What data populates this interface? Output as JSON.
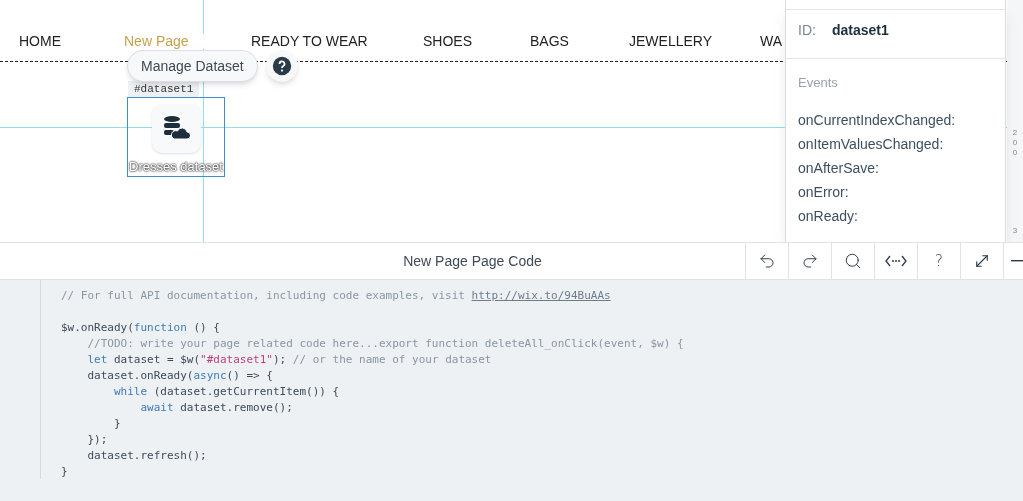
{
  "nav": {
    "items": [
      {
        "label": "HOME",
        "selected": false
      },
      {
        "label": "New Page",
        "selected": true
      },
      {
        "label": "READY TO WEAR",
        "selected": false
      },
      {
        "label": "SHOES",
        "selected": false
      },
      {
        "label": "BAGS",
        "selected": false
      },
      {
        "label": "JEWELLERY",
        "selected": false
      },
      {
        "label": "WA",
        "selected": false
      }
    ]
  },
  "dataset_element": {
    "manage_button": "Manage Dataset",
    "id_tag": "#dataset1",
    "label": "Dresses dataset"
  },
  "properties_panel": {
    "id_label": "ID:",
    "id_value": "dataset1",
    "events_heading": "Events",
    "events": [
      "onCurrentIndexChanged:",
      "onItemValuesChanged:",
      "onAfterSave:",
      "onError:",
      "onReady:"
    ]
  },
  "ruler_labels": [
    "2",
    "0",
    "0",
    "3"
  ],
  "code_panel": {
    "title": "New Page Page Code",
    "toolbar": [
      {
        "kind": "undo"
      },
      {
        "kind": "redo"
      },
      {
        "kind": "search"
      },
      {
        "kind": "snippets"
      },
      {
        "kind": "help",
        "label": "?"
      },
      {
        "kind": "expand"
      },
      {
        "kind": "minimize"
      }
    ],
    "lines": [
      [
        {
          "kind": "comment",
          "text": "// For full API documentation, including code examples, visit "
        },
        {
          "kind": "link",
          "text": "http://wix.to/94BuAAs"
        }
      ],
      [
        {
          "kind": "blank_before"
        },
        {
          "kind": "plain",
          "text": "$w.onReady("
        },
        {
          "kind": "keyword",
          "text": "function"
        },
        {
          "kind": "plain",
          "text": " () {"
        }
      ],
      [
        {
          "kind": "comment",
          "text": "    //TODO: write your page related code here...export function deleteAll_onClick(event, $w) {"
        }
      ],
      [
        {
          "kind": "keyword",
          "text": "    let"
        },
        {
          "kind": "plain",
          "text": " dataset = $w("
        },
        {
          "kind": "string",
          "text": "\"#dataset1\""
        },
        {
          "kind": "plain",
          "text": "); "
        },
        {
          "kind": "comment",
          "text": "// or the name of your dataset"
        }
      ],
      [
        {
          "kind": "plain",
          "text": "    dataset.onReady("
        },
        {
          "kind": "keyword",
          "text": "async"
        },
        {
          "kind": "plain",
          "text": "() => {"
        }
      ],
      [
        {
          "kind": "keyword",
          "text": "        while"
        },
        {
          "kind": "plain",
          "text": " (dataset.getCurrentItem()) {"
        }
      ],
      [
        {
          "kind": "keyword",
          "text": "            await"
        },
        {
          "kind": "plain",
          "text": " dataset.remove();"
        }
      ],
      [
        {
          "kind": "plain",
          "text": "        }"
        }
      ],
      [
        {
          "kind": "plain",
          "text": "    });"
        }
      ],
      [
        {
          "kind": "plain",
          "text": "    dataset.refresh();"
        }
      ],
      [
        {
          "kind": "plain",
          "text": "}"
        }
      ]
    ]
  }
}
